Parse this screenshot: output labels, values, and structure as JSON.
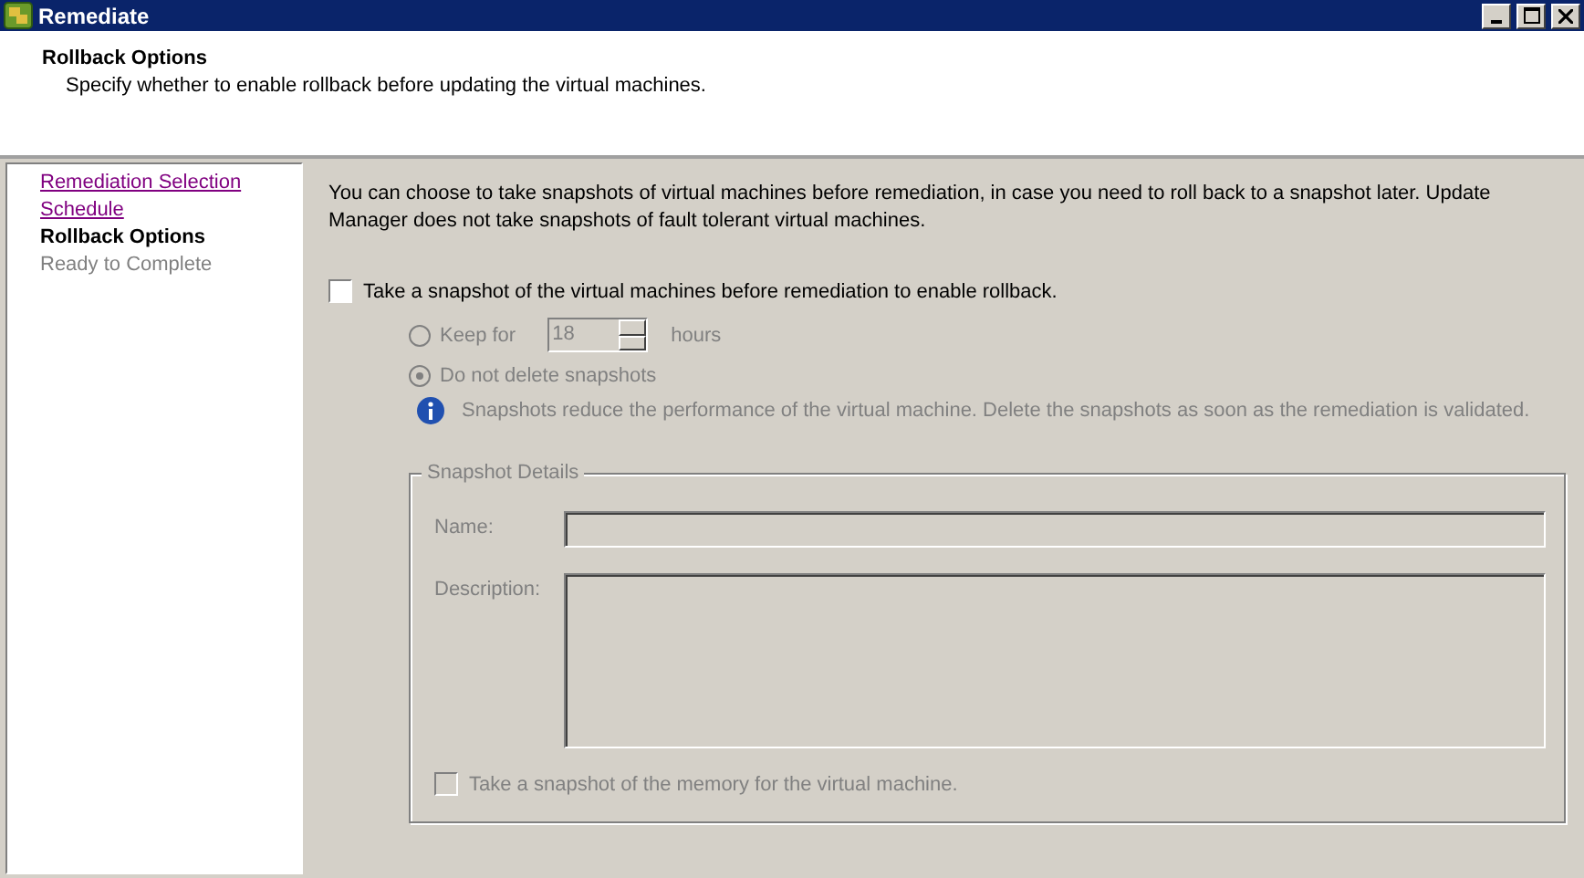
{
  "window": {
    "title": "Remediate"
  },
  "header": {
    "title": "Rollback Options",
    "subtitle": "Specify whether to enable rollback before updating the virtual machines."
  },
  "steps": [
    {
      "label": "Remediation Selection",
      "kind": "visited"
    },
    {
      "label": "Schedule",
      "kind": "visited"
    },
    {
      "label": "Rollback Options",
      "kind": "current"
    },
    {
      "label": "Ready to Complete",
      "kind": "pending"
    }
  ],
  "intro": "You can choose to take snapshots of virtual machines before remediation, in case you need to roll back to a snapshot later. Update Manager does not take snapshots of fault tolerant virtual machines.",
  "snapshot_checkbox": {
    "label": "Take a snapshot of the virtual machines before remediation to enable rollback.",
    "checked": false
  },
  "retention": [
    {
      "kind": "duration",
      "label": "Keep for",
      "value": "18",
      "unit": "hours",
      "selected": false,
      "disabled": true
    },
    {
      "kind": "plain",
      "label": "Do not delete snapshots",
      "selected": true,
      "disabled": true
    }
  ],
  "info_note": "Snapshots reduce the performance of the virtual machine. Delete the snapshots as soon as the remediation is validated.",
  "snapshot_details": {
    "legend": "Snapshot Details",
    "disabled": true,
    "name_label": "Name:",
    "description_label": "Description:",
    "memory_checkbox": {
      "label": "Take a snapshot of the memory for the virtual machine.",
      "checked": false,
      "disabled": true
    }
  }
}
